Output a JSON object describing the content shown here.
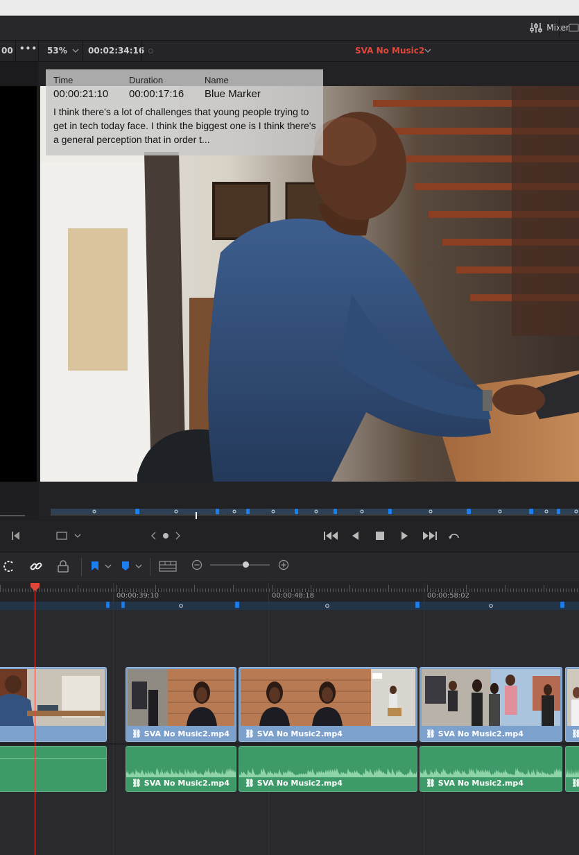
{
  "toolbar": {
    "mixer_label": "Mixer"
  },
  "viewer_bar": {
    "left_timecode": "00",
    "zoom": "53%",
    "timecode": "00:02:34:16",
    "timeline_name": "SVA No Music2"
  },
  "marker_tooltip": {
    "time_header": "Time",
    "duration_header": "Duration",
    "name_header": "Name",
    "time": "00:00:21:10",
    "duration": "00:00:17:16",
    "name": "Blue Marker",
    "note": "I think there's a lot of challenges that young people trying to get in tech today face. I think the biggest one is I think there's a general perception that in order t..."
  },
  "timeline": {
    "ruler_timecodes": [
      "00:00:39:10",
      "00:00:48:18",
      "00:00:58:02"
    ],
    "video_clips": [
      {
        "label": ""
      },
      {
        "label": "SVA No Music2.mp4"
      },
      {
        "label": "SVA No Music2.mp4"
      },
      {
        "label": "SVA No Music2.mp4"
      }
    ],
    "audio_clips": [
      {
        "label": ""
      },
      {
        "label": "SVA No Music2.mp4"
      },
      {
        "label": "SVA No Music2.mp4"
      },
      {
        "label": "SVA No Music2.mp4"
      }
    ]
  },
  "colors": {
    "accent_red": "#e0463a",
    "marker_blue": "#1b7ff0",
    "video_clip": "#7ba1cc",
    "audio_clip": "#3f9a6a"
  },
  "icons": [
    "mixer-icon",
    "more-icon",
    "zoom-dropdown-icon",
    "timeline-dropdown-icon",
    "first-frame-icon",
    "crop-icon",
    "jog-icon",
    "skip-back-icon",
    "play-reverse-icon",
    "stop-icon",
    "play-icon",
    "skip-forward-icon",
    "loop-icon",
    "snapping-icon",
    "link-icon",
    "lock-icon",
    "flag-icon",
    "marker-icon",
    "timeline-view-icon",
    "zoom-out-icon",
    "zoom-in-icon",
    "playhead-icon"
  ]
}
